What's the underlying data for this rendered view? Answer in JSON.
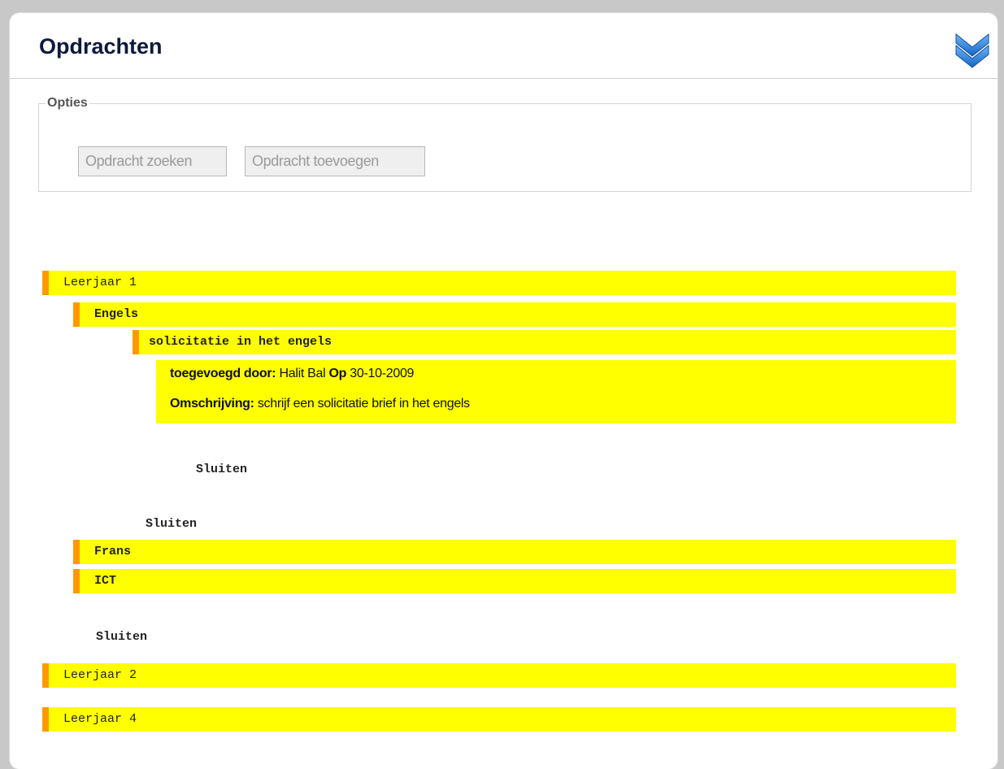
{
  "header": {
    "title": "Opdrachten",
    "collapse_icon": "double-chevron-down-icon"
  },
  "options": {
    "legend": "Opties",
    "search_button": "Opdracht zoeken",
    "add_button": "Opdracht toevoegen"
  },
  "tree": {
    "year1": "Leerjaar 1",
    "engels": "Engels",
    "assignment": "solicitatie in het engels",
    "detail": {
      "added_by_label": "toegevoegd door:",
      "added_by": "Halit Bal",
      "on_label": "Op",
      "date": "30-10-2009",
      "description_label": "Omschrijving:",
      "description": "schrijf een solicitatie brief in het engels"
    },
    "close_assignment": "Sluiten",
    "close_engels": "Sluiten",
    "frans": "Frans",
    "ict": "ICT",
    "close_year1": "Sluiten",
    "year2": "Leerjaar 2",
    "year4": "Leerjaar 4"
  },
  "colors": {
    "highlight": "#ffff00",
    "accent": "#ff9900",
    "title": "#0d1a3d"
  }
}
